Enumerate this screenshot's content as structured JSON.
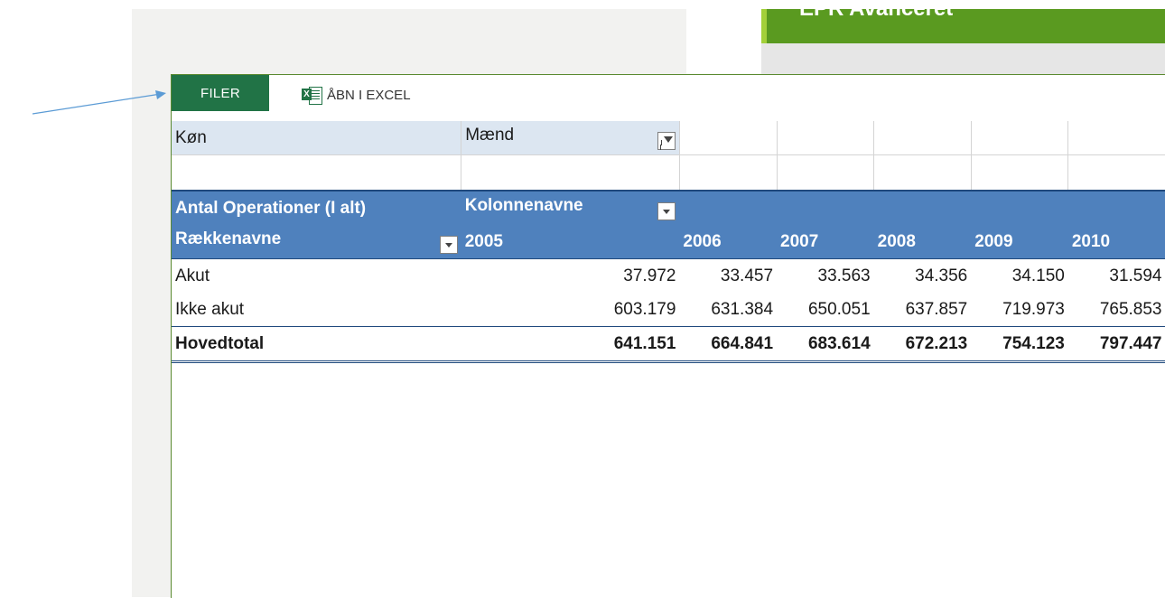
{
  "background": {
    "banner_title": "EPR Avanceret",
    "banner_color": "#5a9a20"
  },
  "toolbar": {
    "filer_label": "FILER",
    "excel_label": "ÅBN I EXCEL",
    "excel_icon": "excel-icon"
  },
  "filter": {
    "field": "Køn",
    "value": "Mænd",
    "icon": "filter-icon"
  },
  "pivot": {
    "value_field": "Antal Operationer (I alt)",
    "column_labels": "Kolonnenavne",
    "row_labels": "Rækkenavne",
    "years": [
      "2005",
      "2006",
      "2007",
      "2008",
      "2009",
      "2010"
    ],
    "rows": [
      {
        "label": "Akut",
        "values": [
          "37.972",
          "33.457",
          "33.563",
          "34.356",
          "34.150",
          "31.594"
        ]
      },
      {
        "label": "Ikke akut",
        "values": [
          "603.179",
          "631.384",
          "650.051",
          "637.857",
          "719.973",
          "765.853"
        ]
      }
    ],
    "total": {
      "label": "Hovedtotal",
      "values": [
        "641.151",
        "664.841",
        "683.614",
        "672.213",
        "754.123",
        "797.447"
      ]
    }
  },
  "colors": {
    "filer_button": "#217346",
    "header_fill": "#4f81bd",
    "filter_fill": "#dce6f1",
    "arrow": "#5b9bd5"
  }
}
